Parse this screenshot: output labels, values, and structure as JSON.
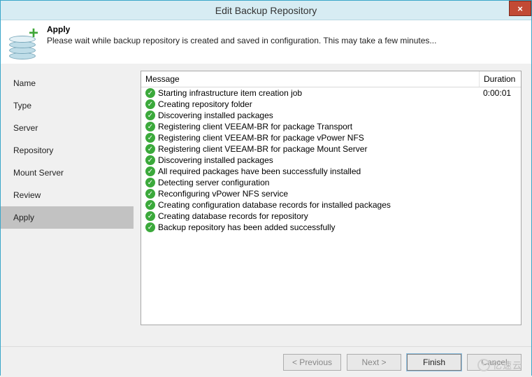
{
  "window": {
    "title": "Edit Backup Repository",
    "close_label": "×"
  },
  "header": {
    "title": "Apply",
    "subtitle": "Please wait while backup repository is created and saved in configuration. This may take a few minutes..."
  },
  "sidebar": {
    "items": [
      {
        "label": "Name",
        "active": false
      },
      {
        "label": "Type",
        "active": false
      },
      {
        "label": "Server",
        "active": false
      },
      {
        "label": "Repository",
        "active": false
      },
      {
        "label": "Mount Server",
        "active": false
      },
      {
        "label": "Review",
        "active": false
      },
      {
        "label": "Apply",
        "active": true
      }
    ]
  },
  "table": {
    "col_message": "Message",
    "col_duration": "Duration",
    "rows": [
      {
        "status": "ok",
        "msg": "Starting infrastructure item creation job",
        "dur": "0:00:01"
      },
      {
        "status": "ok",
        "msg": "Creating repository folder",
        "dur": ""
      },
      {
        "status": "ok",
        "msg": "Discovering installed packages",
        "dur": ""
      },
      {
        "status": "ok",
        "msg": "Registering client VEEAM-BR for package Transport",
        "dur": ""
      },
      {
        "status": "ok",
        "msg": "Registering client VEEAM-BR for package vPower NFS",
        "dur": ""
      },
      {
        "status": "ok",
        "msg": "Registering client VEEAM-BR for package Mount Server",
        "dur": ""
      },
      {
        "status": "ok",
        "msg": "Discovering installed packages",
        "dur": ""
      },
      {
        "status": "ok",
        "msg": "All required packages have been successfully installed",
        "dur": ""
      },
      {
        "status": "ok",
        "msg": "Detecting server configuration",
        "dur": ""
      },
      {
        "status": "ok",
        "msg": "Reconfiguring vPower NFS service",
        "dur": ""
      },
      {
        "status": "ok",
        "msg": "Creating configuration database records for installed packages",
        "dur": ""
      },
      {
        "status": "ok",
        "msg": "Creating database records for repository",
        "dur": ""
      },
      {
        "status": "ok",
        "msg": "Backup repository has been added successfully",
        "dur": ""
      }
    ]
  },
  "buttons": {
    "previous": "< Previous",
    "next": "Next >",
    "finish": "Finish",
    "cancel": "Cancel"
  },
  "watermark": "亿速云"
}
